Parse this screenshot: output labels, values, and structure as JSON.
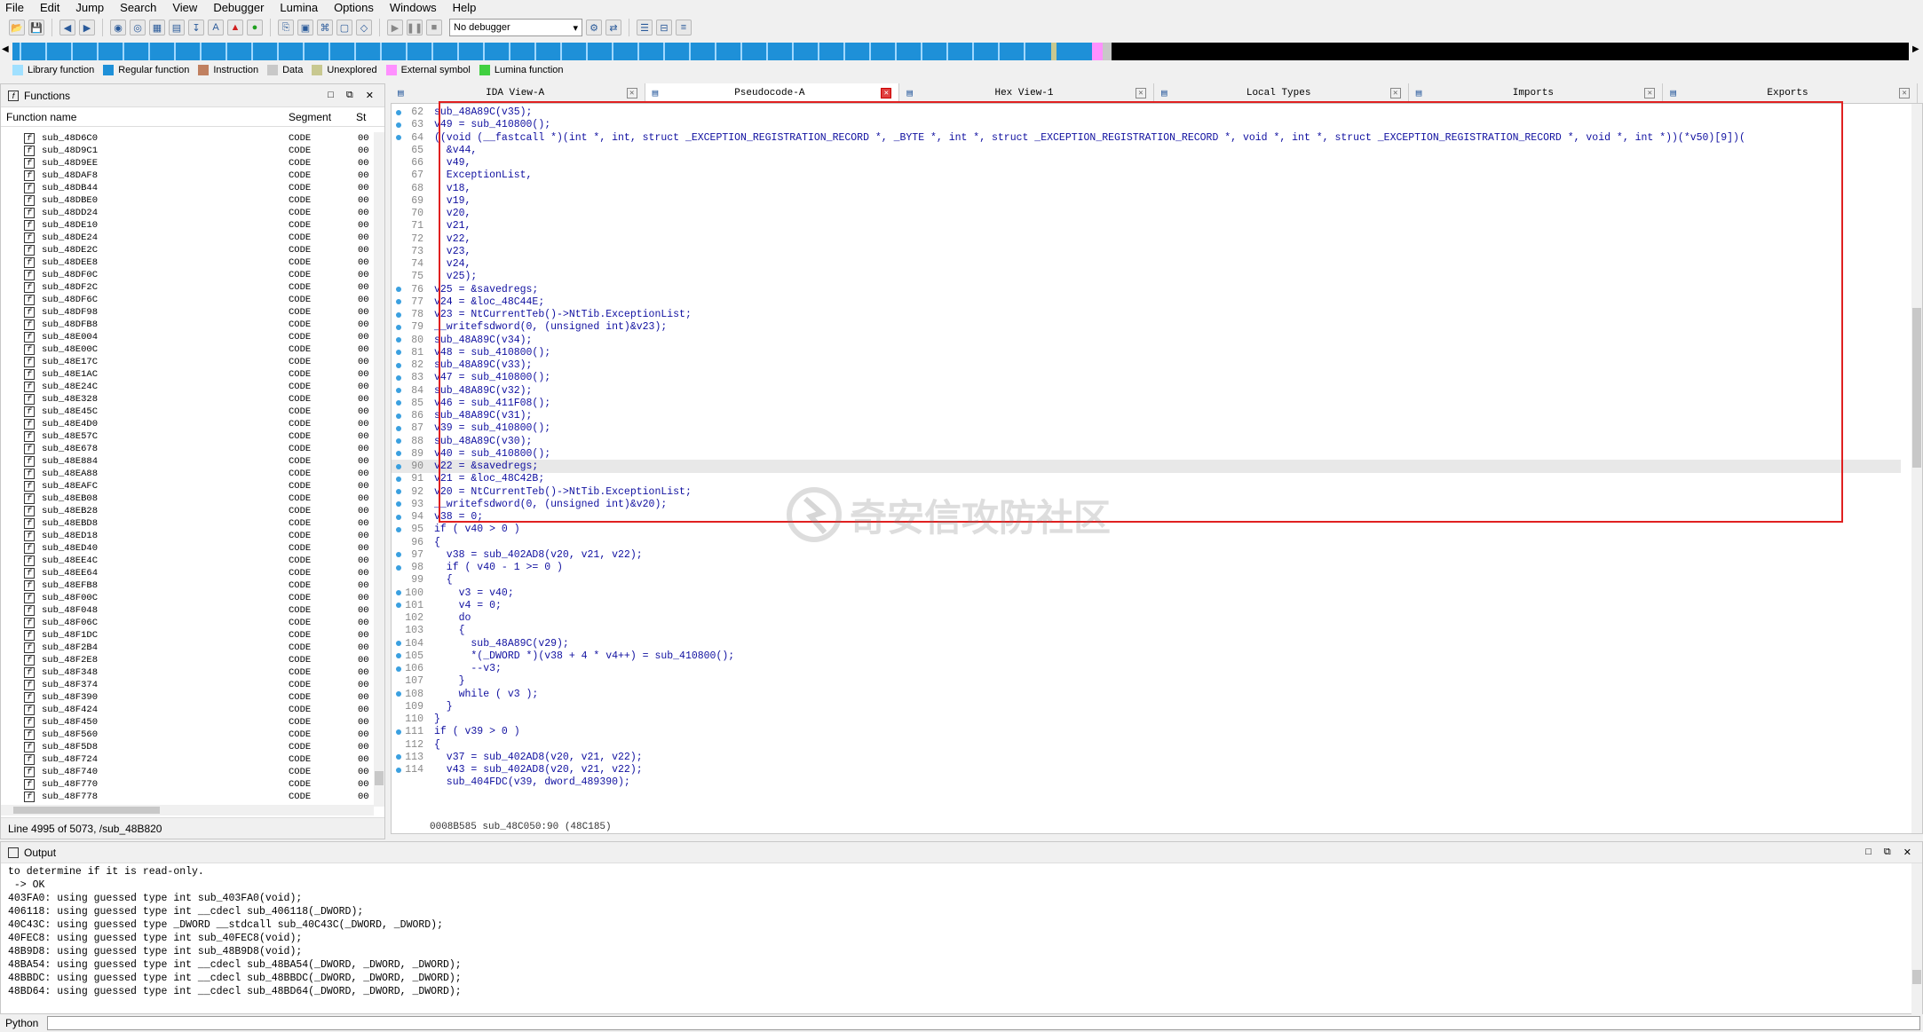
{
  "menu": [
    "File",
    "Edit",
    "Jump",
    "Search",
    "View",
    "Debugger",
    "Lumina",
    "Options",
    "Windows",
    "Help"
  ],
  "debugger_select": "No debugger",
  "legend": [
    {
      "label": "Library function",
      "color": "#a0e0ff"
    },
    {
      "label": "Regular function",
      "color": "#1e90d8"
    },
    {
      "label": "Instruction",
      "color": "#c08060"
    },
    {
      "label": "Data",
      "color": "#c8c8c8"
    },
    {
      "label": "Unexplored",
      "color": "#c8c890"
    },
    {
      "label": "External symbol",
      "color": "#ff90ff"
    },
    {
      "label": "Lumina function",
      "color": "#40d040"
    }
  ],
  "functions_panel": {
    "title": "Functions",
    "col_name": "Function name",
    "col_segment": "Segment",
    "col_st": "St",
    "status": "Line 4995 of 5073, /sub_48B820",
    "rows": [
      {
        "name": "sub_48D6C0",
        "seg": "CODE",
        "st": "00"
      },
      {
        "name": "sub_48D9C1",
        "seg": "CODE",
        "st": "00"
      },
      {
        "name": "sub_48D9EE",
        "seg": "CODE",
        "st": "00"
      },
      {
        "name": "sub_48DAF8",
        "seg": "CODE",
        "st": "00"
      },
      {
        "name": "sub_48DB44",
        "seg": "CODE",
        "st": "00"
      },
      {
        "name": "sub_48DBE0",
        "seg": "CODE",
        "st": "00"
      },
      {
        "name": "sub_48DD24",
        "seg": "CODE",
        "st": "00"
      },
      {
        "name": "sub_48DE10",
        "seg": "CODE",
        "st": "00"
      },
      {
        "name": "sub_48DE24",
        "seg": "CODE",
        "st": "00"
      },
      {
        "name": "sub_48DE2C",
        "seg": "CODE",
        "st": "00"
      },
      {
        "name": "sub_48DEE8",
        "seg": "CODE",
        "st": "00"
      },
      {
        "name": "sub_48DF0C",
        "seg": "CODE",
        "st": "00"
      },
      {
        "name": "sub_48DF2C",
        "seg": "CODE",
        "st": "00"
      },
      {
        "name": "sub_48DF6C",
        "seg": "CODE",
        "st": "00"
      },
      {
        "name": "sub_48DF98",
        "seg": "CODE",
        "st": "00"
      },
      {
        "name": "sub_48DFB8",
        "seg": "CODE",
        "st": "00"
      },
      {
        "name": "sub_48E004",
        "seg": "CODE",
        "st": "00"
      },
      {
        "name": "sub_48E00C",
        "seg": "CODE",
        "st": "00"
      },
      {
        "name": "sub_48E17C",
        "seg": "CODE",
        "st": "00"
      },
      {
        "name": "sub_48E1AC",
        "seg": "CODE",
        "st": "00"
      },
      {
        "name": "sub_48E24C",
        "seg": "CODE",
        "st": "00"
      },
      {
        "name": "sub_48E328",
        "seg": "CODE",
        "st": "00"
      },
      {
        "name": "sub_48E45C",
        "seg": "CODE",
        "st": "00"
      },
      {
        "name": "sub_48E4D0",
        "seg": "CODE",
        "st": "00"
      },
      {
        "name": "sub_48E57C",
        "seg": "CODE",
        "st": "00"
      },
      {
        "name": "sub_48E678",
        "seg": "CODE",
        "st": "00"
      },
      {
        "name": "sub_48E884",
        "seg": "CODE",
        "st": "00"
      },
      {
        "name": "sub_48EA88",
        "seg": "CODE",
        "st": "00"
      },
      {
        "name": "sub_48EAFC",
        "seg": "CODE",
        "st": "00"
      },
      {
        "name": "sub_48EB08",
        "seg": "CODE",
        "st": "00"
      },
      {
        "name": "sub_48EB28",
        "seg": "CODE",
        "st": "00"
      },
      {
        "name": "sub_48EBD8",
        "seg": "CODE",
        "st": "00"
      },
      {
        "name": "sub_48ED18",
        "seg": "CODE",
        "st": "00"
      },
      {
        "name": "sub_48ED40",
        "seg": "CODE",
        "st": "00"
      },
      {
        "name": "sub_48EE4C",
        "seg": "CODE",
        "st": "00"
      },
      {
        "name": "sub_48EE64",
        "seg": "CODE",
        "st": "00"
      },
      {
        "name": "sub_48EFB8",
        "seg": "CODE",
        "st": "00"
      },
      {
        "name": "sub_48F00C",
        "seg": "CODE",
        "st": "00"
      },
      {
        "name": "sub_48F048",
        "seg": "CODE",
        "st": "00"
      },
      {
        "name": "sub_48F06C",
        "seg": "CODE",
        "st": "00"
      },
      {
        "name": "sub_48F1DC",
        "seg": "CODE",
        "st": "00"
      },
      {
        "name": "sub_48F2B4",
        "seg": "CODE",
        "st": "00"
      },
      {
        "name": "sub_48F2E8",
        "seg": "CODE",
        "st": "00"
      },
      {
        "name": "sub_48F348",
        "seg": "CODE",
        "st": "00"
      },
      {
        "name": "sub_48F374",
        "seg": "CODE",
        "st": "00"
      },
      {
        "name": "sub_48F390",
        "seg": "CODE",
        "st": "00"
      },
      {
        "name": "sub_48F424",
        "seg": "CODE",
        "st": "00"
      },
      {
        "name": "sub_48F450",
        "seg": "CODE",
        "st": "00"
      },
      {
        "name": "sub_48F560",
        "seg": "CODE",
        "st": "00"
      },
      {
        "name": "sub_48F5D8",
        "seg": "CODE",
        "st": "00"
      },
      {
        "name": "sub_48F724",
        "seg": "CODE",
        "st": "00"
      },
      {
        "name": "sub_48F740",
        "seg": "CODE",
        "st": "00"
      },
      {
        "name": "sub_48F770",
        "seg": "CODE",
        "st": "00"
      },
      {
        "name": "sub_48F778",
        "seg": "CODE",
        "st": "00"
      }
    ]
  },
  "tabs": [
    {
      "label": "IDA View-A",
      "active": false
    },
    {
      "label": "Pseudocode-A",
      "active": true
    },
    {
      "label": "Hex View-1",
      "active": false
    },
    {
      "label": "Local Types",
      "active": false
    },
    {
      "label": "Imports",
      "active": false
    },
    {
      "label": "Exports",
      "active": false
    }
  ],
  "code": [
    {
      "n": "62",
      "t": "sub_48A89C(v35);",
      "d": true
    },
    {
      "n": "63",
      "t": "v49 = sub_410800();",
      "d": true
    },
    {
      "n": "64",
      "t": "((void (__fastcall *)(int *, int, struct _EXCEPTION_REGISTRATION_RECORD *, _BYTE *, int *, struct _EXCEPTION_REGISTRATION_RECORD *, void *, int *, struct _EXCEPTION_REGISTRATION_RECORD *, void *, int *))(*v50)[9])(",
      "d": true
    },
    {
      "n": "65",
      "t": "  &v44,",
      "d": false
    },
    {
      "n": "66",
      "t": "  v49,",
      "d": false
    },
    {
      "n": "67",
      "t": "  ExceptionList,",
      "d": false
    },
    {
      "n": "68",
      "t": "  v18,",
      "d": false
    },
    {
      "n": "69",
      "t": "  v19,",
      "d": false
    },
    {
      "n": "70",
      "t": "  v20,",
      "d": false
    },
    {
      "n": "71",
      "t": "  v21,",
      "d": false
    },
    {
      "n": "72",
      "t": "  v22,",
      "d": false
    },
    {
      "n": "73",
      "t": "  v23,",
      "d": false
    },
    {
      "n": "74",
      "t": "  v24,",
      "d": false
    },
    {
      "n": "75",
      "t": "  v25);",
      "d": false
    },
    {
      "n": "76",
      "t": "v25 = &savedregs;",
      "d": true
    },
    {
      "n": "77",
      "t": "v24 = &loc_48C44E;",
      "d": true
    },
    {
      "n": "78",
      "t": "v23 = NtCurrentTeb()->NtTib.ExceptionList;",
      "d": true
    },
    {
      "n": "79",
      "t": "__writefsdword(0, (unsigned int)&v23);",
      "d": true
    },
    {
      "n": "80",
      "t": "sub_48A89C(v34);",
      "d": true
    },
    {
      "n": "81",
      "t": "v48 = sub_410800();",
      "d": true
    },
    {
      "n": "82",
      "t": "sub_48A89C(v33);",
      "d": true
    },
    {
      "n": "83",
      "t": "v47 = sub_410800();",
      "d": true
    },
    {
      "n": "84",
      "t": "sub_48A89C(v32);",
      "d": true
    },
    {
      "n": "85",
      "t": "v46 = sub_411F08();",
      "d": true
    },
    {
      "n": "86",
      "t": "sub_48A89C(v31);",
      "d": true
    },
    {
      "n": "87",
      "t": "v39 = sub_410800();",
      "d": true
    },
    {
      "n": "88",
      "t": "sub_48A89C(v30);",
      "d": true
    },
    {
      "n": "89",
      "t": "v40 = sub_410800();",
      "d": true
    },
    {
      "n": "90",
      "t": "v22 = &savedregs;",
      "d": true,
      "hl": true
    },
    {
      "n": "91",
      "t": "v21 = &loc_48C42B;",
      "d": true
    },
    {
      "n": "92",
      "t": "v20 = NtCurrentTeb()->NtTib.ExceptionList;",
      "d": true
    },
    {
      "n": "93",
      "t": "__writefsdword(0, (unsigned int)&v20);",
      "d": true
    },
    {
      "n": "94",
      "t": "v38 = 0;",
      "d": true
    },
    {
      "n": "95",
      "t": "if ( v40 > 0 )",
      "d": true
    },
    {
      "n": "96",
      "t": "{",
      "d": false
    },
    {
      "n": "97",
      "t": "  v38 = sub_402AD8(v20, v21, v22);",
      "d": true
    },
    {
      "n": "98",
      "t": "  if ( v40 - 1 >= 0 )",
      "d": true
    },
    {
      "n": "99",
      "t": "  {",
      "d": false
    },
    {
      "n": "100",
      "t": "    v3 = v40;",
      "d": true
    },
    {
      "n": "101",
      "t": "    v4 = 0;",
      "d": true
    },
    {
      "n": "102",
      "t": "    do",
      "d": false
    },
    {
      "n": "103",
      "t": "    {",
      "d": false
    },
    {
      "n": "104",
      "t": "      sub_48A89C(v29);",
      "d": true
    },
    {
      "n": "105",
      "t": "      *(_DWORD *)(v38 + 4 * v4++) = sub_410800();",
      "d": true
    },
    {
      "n": "106",
      "t": "      --v3;",
      "d": true
    },
    {
      "n": "107",
      "t": "    }",
      "d": false
    },
    {
      "n": "108",
      "t": "    while ( v3 );",
      "d": true
    },
    {
      "n": "109",
      "t": "  }",
      "d": false
    },
    {
      "n": "110",
      "t": "}",
      "d": false
    },
    {
      "n": "111",
      "t": "if ( v39 > 0 )",
      "d": true
    },
    {
      "n": "112",
      "t": "{",
      "d": false
    },
    {
      "n": "113",
      "t": "  v37 = sub_402AD8(v20, v21, v22);",
      "d": true
    },
    {
      "n": "114",
      "t": "  v43 = sub_402AD8(v20, v21, v22);",
      "d": true
    },
    {
      "n": "",
      "t": "  sub_404FDC(v39, dword_489390);",
      "d": false
    }
  ],
  "editor_status": "0008B585 sub_48C050:90 (48C185)",
  "watermark": "奇安信攻防社区",
  "output": {
    "title": "Output",
    "lines": [
      "to determine if it is read-only.",
      " -> OK",
      "403FA0: using guessed type int sub_403FA0(void);",
      "406118: using guessed type int __cdecl sub_406118(_DWORD);",
      "40C43C: using guessed type _DWORD __stdcall sub_40C43C(_DWORD, _DWORD);",
      "40FEC8: using guessed type int sub_40FEC8(void);",
      "48B9D8: using guessed type int sub_48B9D8(void);",
      "48BA54: using guessed type int __cdecl sub_48BA54(_DWORD, _DWORD, _DWORD);",
      "48BBDC: using guessed type int __cdecl sub_48BBDC(_DWORD, _DWORD, _DWORD);",
      "48BD64: using guessed type int __cdecl sub_48BD64(_DWORD, _DWORD, _DWORD);"
    ]
  },
  "python_label": "Python"
}
